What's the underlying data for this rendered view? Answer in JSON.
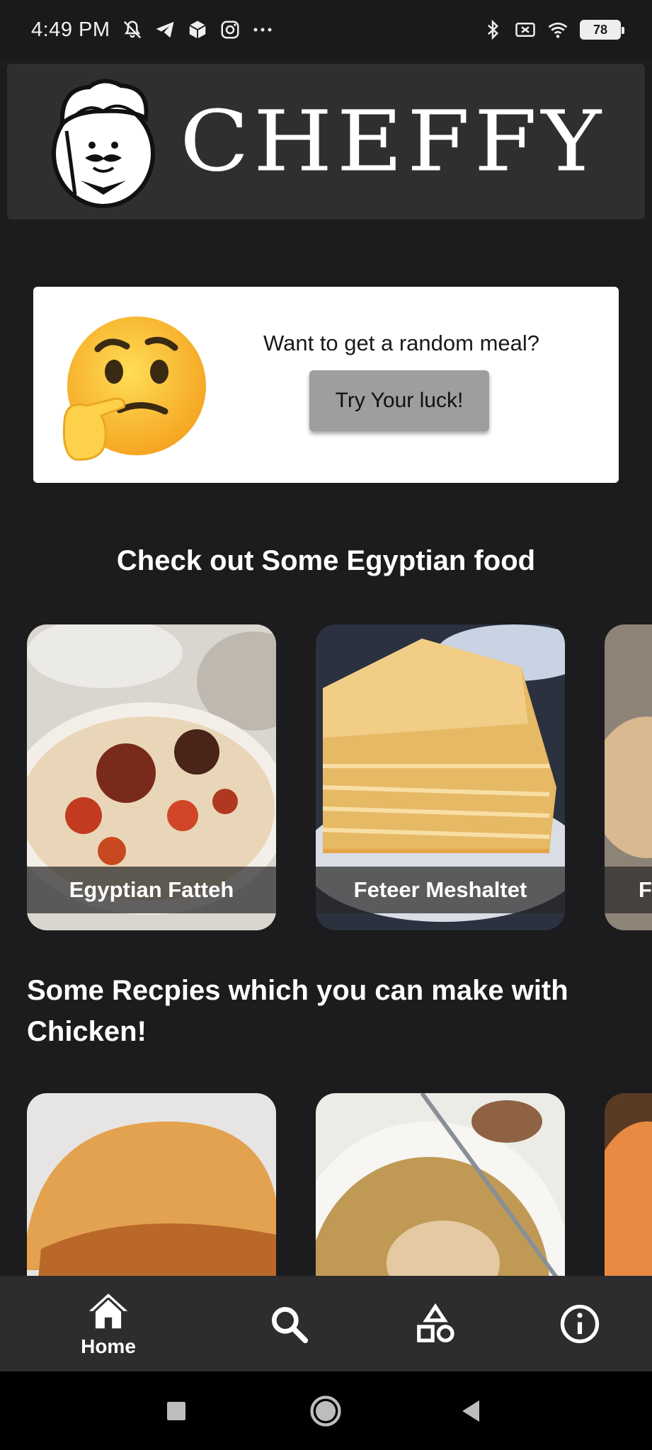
{
  "status_bar": {
    "time": "4:49 PM",
    "battery": "78"
  },
  "header": {
    "brand": "CHEFFY"
  },
  "random_card": {
    "prompt": "Want to get a random meal?",
    "button_label": "Try Your luck!"
  },
  "egyptian_section": {
    "title": "Check out Some Egyptian food",
    "cards": [
      {
        "label": "Egyptian Fatteh"
      },
      {
        "label": "Feteer Meshaltet"
      },
      {
        "label": "Fu"
      }
    ]
  },
  "chicken_section": {
    "title": "Some Recpies which you can make with Chicken!"
  },
  "bottom_nav": {
    "items": [
      {
        "label": "Home",
        "icon": "home-icon"
      },
      {
        "label": "",
        "icon": "search-icon"
      },
      {
        "label": "",
        "icon": "categories-icon"
      },
      {
        "label": "",
        "icon": "info-icon"
      }
    ]
  },
  "colors": {
    "background": "#1c1b1d",
    "header_bg": "#2f2e30",
    "nav_bg": "#2d2c2e",
    "button_gray": "#9e9e9e"
  }
}
